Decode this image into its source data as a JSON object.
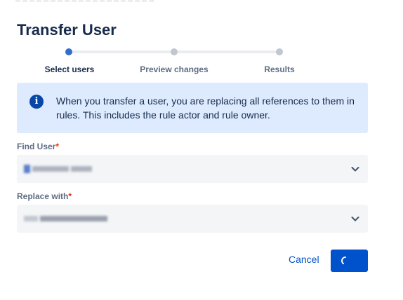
{
  "dialog": {
    "title": "Transfer User",
    "steps": [
      {
        "label": "Select users",
        "state": "active"
      },
      {
        "label": "Preview changes",
        "state": "inactive"
      },
      {
        "label": "Results",
        "state": "inactive"
      }
    ],
    "info_message": "When you transfer a user, you are replacing all references to them in rules. This includes the rule actor and rule owner.",
    "find_user": {
      "label": "Find User",
      "required_mark": "*"
    },
    "replace_with": {
      "label": "Replace with",
      "required_mark": "*"
    },
    "actions": {
      "cancel_label": "Cancel",
      "primary_state": "loading"
    }
  },
  "colors": {
    "primary": "#0052cc",
    "info_background": "#deebff",
    "info_icon": "#0747a6",
    "active_step": "#2f6fcb",
    "required": "#de350b"
  },
  "icons": {
    "info": "info-icon",
    "dropdown": "chevron-down-icon",
    "loading": "spinner-icon"
  }
}
